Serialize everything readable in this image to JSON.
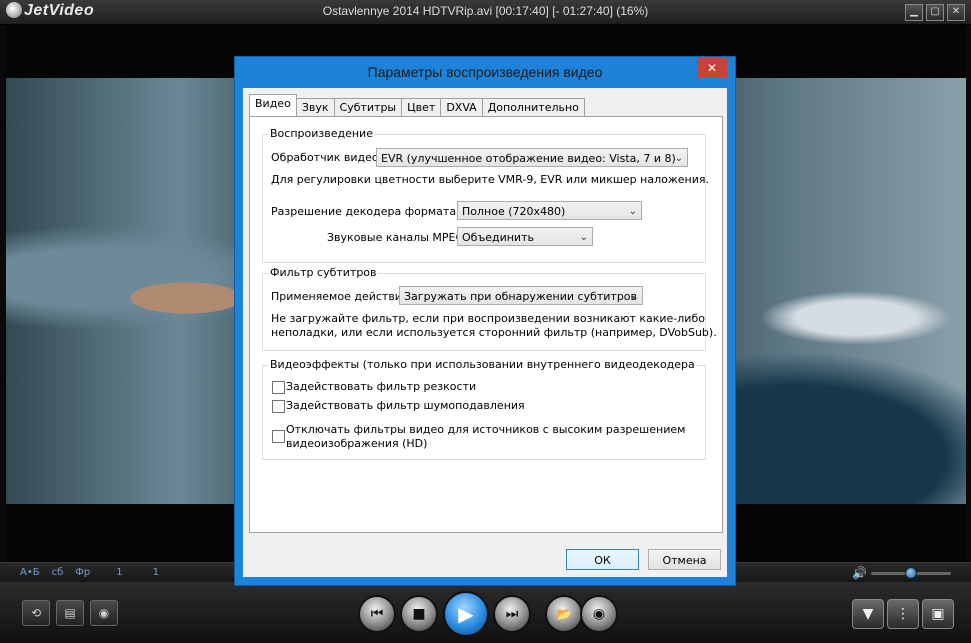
{
  "app": {
    "logo": "JetVideo",
    "caption": "Ostavlennye 2014 HDTVRip.avi [00:17:40] [- 01:27:40] (16%)",
    "window_buttons": [
      "▁",
      "▢",
      "✕"
    ]
  },
  "seekbar": {
    "audio_label": "А•Б",
    "subs_label": "сб",
    "frame_label": "Фр",
    "audio_track": "1",
    "subs_track": "1",
    "progress_percent": 16
  },
  "controls": {
    "prev": "⏮",
    "stop": "■",
    "play": "▶",
    "next": "⏭",
    "open": "📂",
    "disc": "◉"
  },
  "dialog": {
    "title": "Параметры воспроизведения видео",
    "close": "✕",
    "tabs": [
      "Видео",
      "Звук",
      "Субтитры",
      "Цвет",
      "DXVA",
      "Дополнительно"
    ],
    "playback": {
      "group": "Воспроизведение",
      "renderer_label": "Обработчик видео:",
      "renderer_value": "EVR (улучшенное отображение видео: Vista, 7 и 8)",
      "hint": "Для регулировки цветности выберите VMR-9, EVR или микшер наложения.",
      "dv_label": "Разрешение декодера формата DV:",
      "dv_value": "Полное (720x480)",
      "mpeg_label": "Звуковые каналы MPEG:",
      "mpeg_value": "Объединить"
    },
    "subs": {
      "group": "Фильтр субтитров",
      "action_label": "Применяемое действие:",
      "action_value": "Загружать при обнаружении субтитров",
      "hint_line1": "Не загружайте фильтр, если при воспроизведении возникают какие-либо",
      "hint_line2": "неполадки, или если используется сторонний фильтр (например, DVobSub)."
    },
    "effects": {
      "group": "Видеоэффекты (только при использовании внутреннего видеодекодера",
      "sharpen": "Задействовать фильтр резкости",
      "denoise": "Задействовать фильтр шумоподавления",
      "hd_line1": "Отключать фильтры видео для источников с высоким разрешением",
      "hd_line2": "видеоизображения (HD)"
    },
    "ok": "ОК",
    "cancel": "Отмена"
  }
}
